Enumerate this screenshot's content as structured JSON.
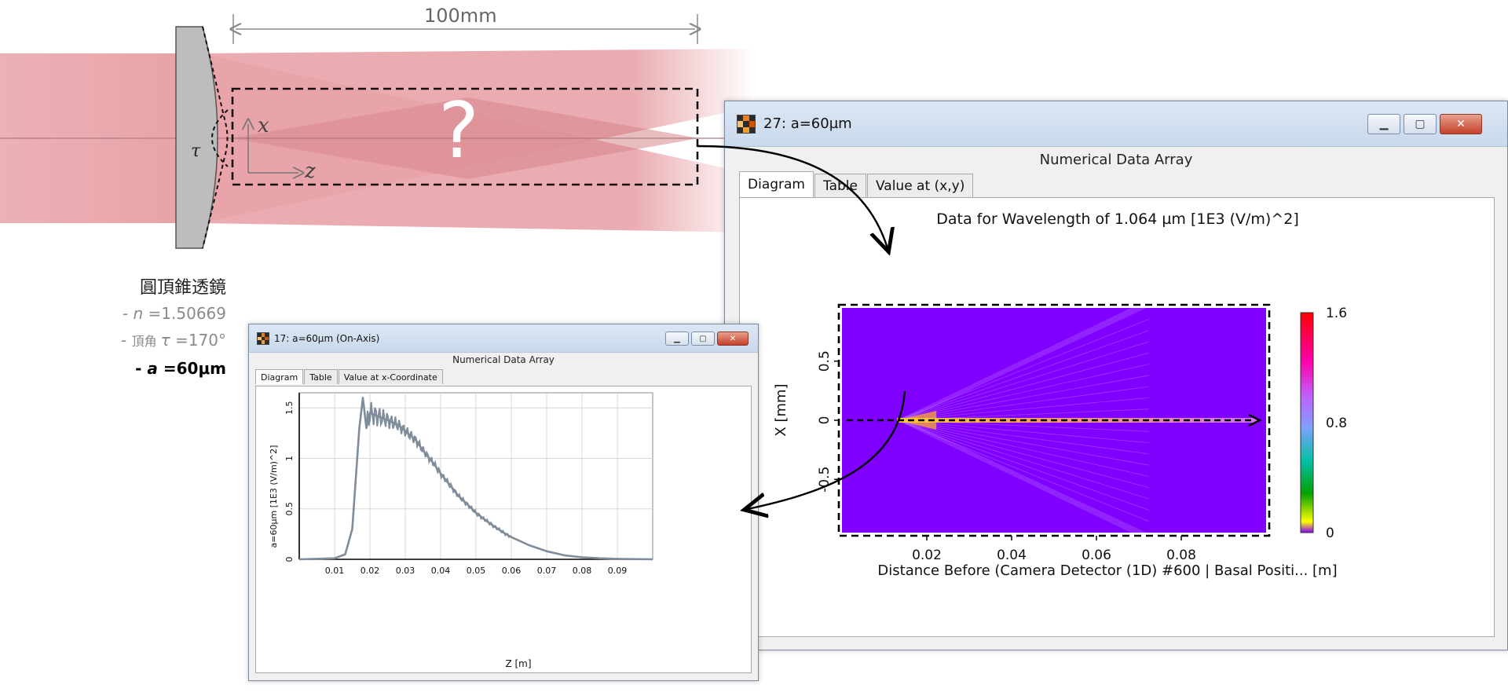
{
  "diagram": {
    "dimension": "100mm",
    "question": "?",
    "axis_x": "x",
    "axis_z": "z",
    "angle_symbol": "τ",
    "lens_name": "圓頂錐透鏡",
    "param_n_prefix": "- ",
    "param_n_symbol": "n",
    "param_n_value": " =1.50669",
    "param_tau_prefix": "- ",
    "param_tau_word": "頂角 ",
    "param_tau_symbol": "τ",
    "param_tau_value": " =170°",
    "param_a_prefix": "- ",
    "param_a_symbol": "a",
    "param_a_value": " =60μm",
    "colors": {
      "beam": "#e8a3a8",
      "beam_overlap": "#d98d93",
      "lens": "#bdbdbd"
    }
  },
  "big_window": {
    "title": "27: a=60µm",
    "subheader": "Numerical Data Array",
    "tabs": [
      "Diagram",
      "Table",
      "Value at (x,y)"
    ],
    "active_tab": 0,
    "controls": {
      "minimize": "▁",
      "maximize": "▢",
      "close": "✕"
    },
    "plot_title": "Data for Wavelength of 1.064 µm  [1E3 (V/m)^2]",
    "xlabel": "Distance Before (Camera Detector (1D) #600 | Basal Positi... [m]",
    "ylabel": "X [mm]",
    "x_ticks": [
      "0.02",
      "0.04",
      "0.06",
      "0.08"
    ],
    "y_ticks": [
      "0.5",
      "0",
      "-0.5"
    ],
    "colorbar_ticks": [
      "1.6",
      "0.8",
      "0"
    ]
  },
  "small_window": {
    "title": "17: a=60µm (On-Axis)",
    "subheader": "Numerical Data Array",
    "tabs": [
      "Diagram",
      "Table",
      "Value at x-Coordinate"
    ],
    "active_tab": 0,
    "controls": {
      "minimize": "▁",
      "maximize": "▢",
      "close": "✕"
    },
    "xlabel": "Z [m]",
    "ylabel": "a=60µm [1E3 (V/m)^2]",
    "x_ticks": [
      "0.01",
      "0.02",
      "0.03",
      "0.04",
      "0.05",
      "0.06",
      "0.07",
      "0.08",
      "0.09"
    ],
    "y_ticks": [
      "1.5",
      "1",
      "0.5",
      "0"
    ]
  },
  "chart_data": [
    {
      "type": "heatmap",
      "title": "Data for Wavelength of 1.064 µm  [1E3 (V/m)^2]",
      "xlabel": "Distance Before (Camera Detector (1D) #600 | Basal Positi... [m]",
      "ylabel": "X [mm]",
      "xlim": [
        0.0,
        0.1
      ],
      "ylim": [
        -0.95,
        0.95
      ],
      "colorbar_range": [
        0,
        1.6
      ],
      "colorbar_ticks": [
        0,
        0.8,
        1.6
      ],
      "x_ticks": [
        0.02,
        0.04,
        0.06,
        0.08
      ],
      "y_ticks": [
        -0.5,
        0,
        0.5
      ],
      "focal_start_x": 0.013,
      "cone_end_x": 0.057,
      "cone_end_halfwidth": 0.95,
      "colormap": [
        "#8000ff",
        "#ff00ff",
        "#7fa0ff",
        "#00c0a0",
        "#00a000",
        "#ffff00",
        "#8000ff"
      ]
    },
    {
      "type": "line",
      "xlabel": "Z [m]",
      "ylabel": "a=60µm [1E3 (V/m)^2]",
      "xlim": [
        0.0,
        0.1
      ],
      "ylim": [
        0,
        1.65
      ],
      "x_ticks": [
        0.01,
        0.02,
        0.03,
        0.04,
        0.05,
        0.06,
        0.07,
        0.08,
        0.09
      ],
      "y_ticks": [
        0,
        0.5,
        1,
        1.5
      ],
      "series": [
        {
          "color": "#7f8c9a",
          "x": [
            0,
            0.01,
            0.013,
            0.015,
            0.016,
            0.017,
            0.018,
            0.019,
            0.02,
            0.022,
            0.025,
            0.028,
            0.03,
            0.033,
            0.035,
            0.038,
            0.04,
            0.043,
            0.045,
            0.048,
            0.05,
            0.053,
            0.055,
            0.058,
            0.06,
            0.065,
            0.07,
            0.075,
            0.08,
            0.085,
            0.09,
            0.1
          ],
          "y": [
            0,
            0.01,
            0.05,
            0.3,
            0.8,
            1.3,
            1.6,
            1.3,
            1.45,
            1.42,
            1.38,
            1.33,
            1.27,
            1.18,
            1.08,
            0.95,
            0.85,
            0.72,
            0.63,
            0.53,
            0.46,
            0.38,
            0.33,
            0.26,
            0.22,
            0.14,
            0.08,
            0.04,
            0.02,
            0.01,
            0.005,
            0
          ]
        }
      ]
    }
  ]
}
